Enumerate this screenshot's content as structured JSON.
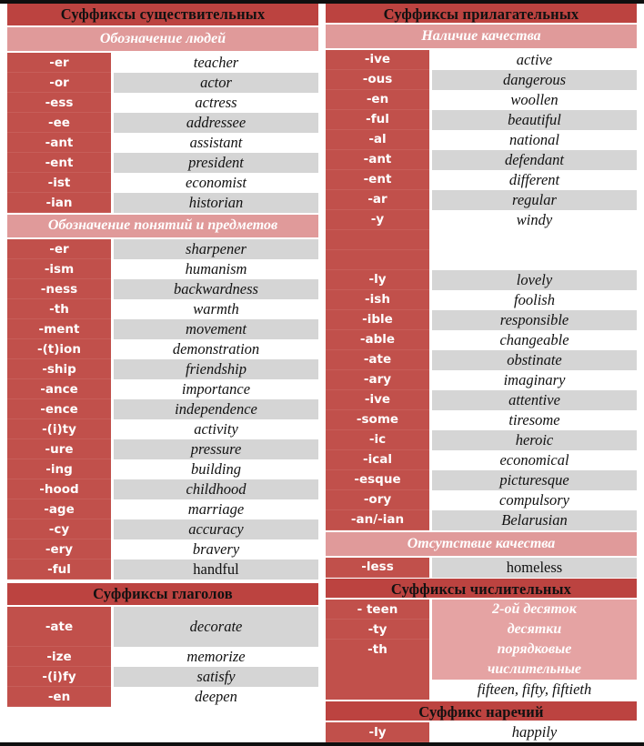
{
  "left": {
    "title": "Суффиксы существительных",
    "sections": [
      {
        "subtitle": "Обозначение людей",
        "rows": [
          {
            "suffix": "-er",
            "value": "teacher"
          },
          {
            "suffix": "-or",
            "value": "actor"
          },
          {
            "suffix": "-ess",
            "value": "actress"
          },
          {
            "suffix": "-ee",
            "value": "addressee"
          },
          {
            "suffix": "-ant",
            "value": "assistant"
          },
          {
            "suffix": "-ent",
            "value": "president"
          },
          {
            "suffix": "-ist",
            "value": "economist"
          },
          {
            "suffix": "-ian",
            "value": "historian"
          }
        ]
      },
      {
        "subtitle": "Обозначение понятий и предметов",
        "rows": [
          {
            "suffix": "-er",
            "value": "sharpener"
          },
          {
            "suffix": "-ism",
            "value": "humanism"
          },
          {
            "suffix": "-ness",
            "value": "backwardness"
          },
          {
            "suffix": "-th",
            "value": "warmth"
          },
          {
            "suffix": "-ment",
            "value": "movement"
          },
          {
            "suffix": "-(t)ion",
            "value": "demonstration"
          },
          {
            "suffix": "-ship",
            "value": "friendship"
          },
          {
            "suffix": "-ance",
            "value": "importance"
          },
          {
            "suffix": "-ence",
            "value": "independence"
          },
          {
            "suffix": "-(i)ty",
            "value": "activity"
          },
          {
            "suffix": "-ure",
            "value": "pressure"
          },
          {
            "suffix": "-ing",
            "value": "building"
          },
          {
            "suffix": "-hood",
            "value": "childhood"
          },
          {
            "suffix": "-age",
            "value": "marriage"
          },
          {
            "suffix": "-cy",
            "value": "accuracy"
          },
          {
            "suffix": "-ery",
            "value": "bravery"
          },
          {
            "suffix": "-ful",
            "value": "handful"
          }
        ]
      }
    ],
    "verbs": {
      "title": "Суффиксы глаголов",
      "rows": [
        {
          "suffix": "-ate",
          "value": "decorate"
        },
        {
          "suffix": "-ize",
          "value": "memorize"
        },
        {
          "suffix": "-(i)fy",
          "value": "satisfy"
        },
        {
          "suffix": "-en",
          "value": "deepen"
        }
      ]
    }
  },
  "right": {
    "title": "Суффиксы прилагательных",
    "quality_subtitle": "Наличие качества",
    "quality_rows_top": [
      {
        "suffix": "-ive",
        "value": "active"
      },
      {
        "suffix": "-ous",
        "value": "dangerous"
      },
      {
        "suffix": "-en",
        "value": "woollen"
      },
      {
        "suffix": "-ful",
        "value": "beautiful"
      },
      {
        "suffix": "-al",
        "value": "national"
      },
      {
        "suffix": "-ant",
        "value": "defendant"
      },
      {
        "suffix": "-ent",
        "value": "different"
      },
      {
        "suffix": "-ar",
        "value": "regular"
      },
      {
        "suffix": "-y",
        "value": "windy"
      }
    ],
    "quality_rows_bottom": [
      {
        "suffix": "-ly",
        "value": "lovely"
      },
      {
        "suffix": "-ish",
        "value": "foolish"
      },
      {
        "suffix": "-ible",
        "value": "responsible"
      },
      {
        "suffix": "-able",
        "value": "changeable"
      },
      {
        "suffix": "-ate",
        "value": "obstinate"
      },
      {
        "suffix": "-ary",
        "value": "imaginary"
      },
      {
        "suffix": "-ive",
        "value": "attentive"
      },
      {
        "suffix": "-some",
        "value": "tiresome"
      },
      {
        "suffix": "-ic",
        "value": "heroic"
      },
      {
        "suffix": "-ical",
        "value": "economical"
      },
      {
        "suffix": "-esque",
        "value": "picturesque"
      },
      {
        "suffix": "-ory",
        "value": "compulsory"
      },
      {
        "suffix": "-an/-ian",
        "value": "Belarusian"
      }
    ],
    "no_quality_subtitle": "Отсутствие качества",
    "no_quality_rows": [
      {
        "suffix": "-less",
        "value": "homeless"
      }
    ],
    "numerals": {
      "title": "Суффиксы числительных",
      "rows": [
        {
          "suffix": "- teen",
          "value": "2-ой десяток"
        },
        {
          "suffix": "-ty",
          "value": "десятки"
        }
      ],
      "ordinal": {
        "suffix": "-th",
        "line1": "порядковые",
        "line2": "числительные",
        "examples": "fifteen, fifty, fiftieth"
      }
    },
    "adverbs": {
      "title": "Суффикс наречий",
      "rows": [
        {
          "suffix": "-ly",
          "value": "happily"
        }
      ]
    }
  },
  "colors": {
    "header_red": "#bc4340",
    "subheader_pink": "#e09a9a",
    "cell_red": "#c1504b",
    "row_gray": "#d5d5d5",
    "value_pink": "#e5a3a3"
  }
}
